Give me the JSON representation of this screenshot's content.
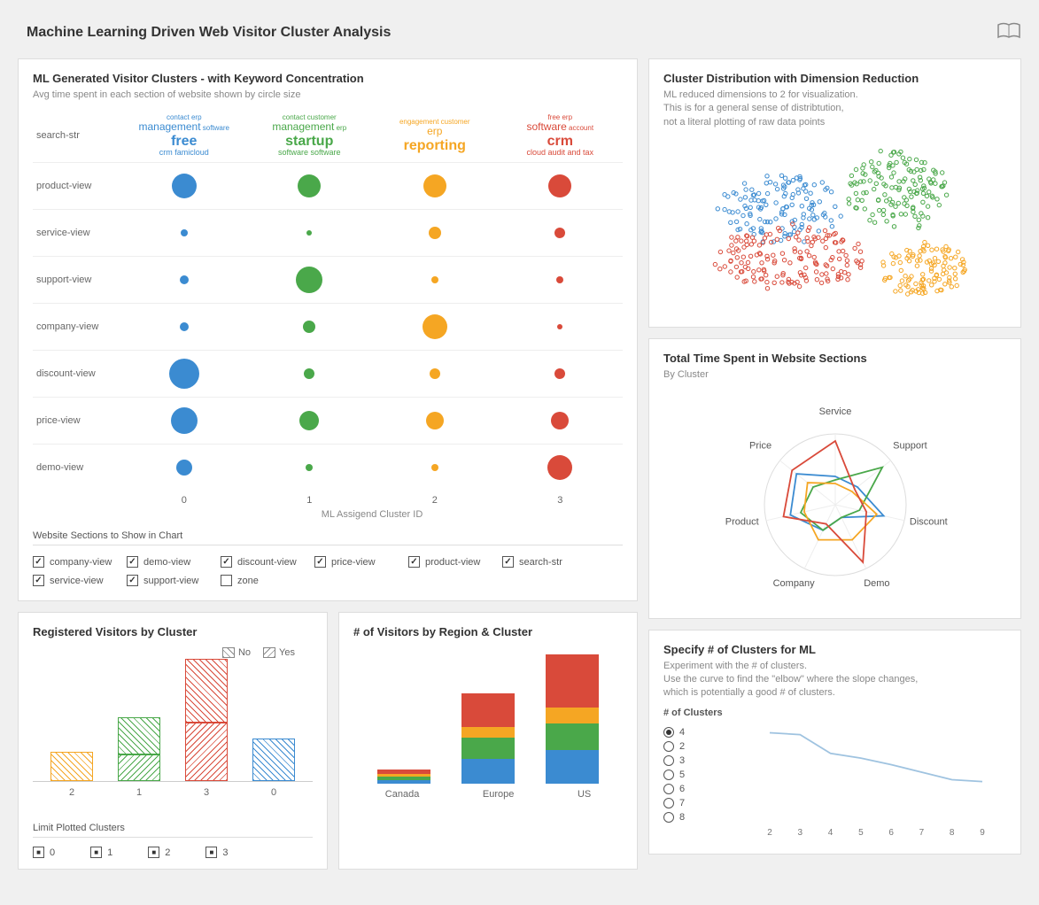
{
  "header": {
    "title": "Machine Learning Driven Web Visitor Cluster Analysis"
  },
  "colors": {
    "c0": "#3b8bd1",
    "c1": "#4aa84a",
    "c2": "#f5a623",
    "c3": "#d94a3a"
  },
  "bubble_panel": {
    "title": "ML Generated Visitor Clusters - with Keyword Concentration",
    "subtitle": "Avg time spent in each section of website shown by circle size",
    "xaxis": "ML Assigend Cluster ID",
    "rows": [
      "search-str",
      "product-view",
      "service-view",
      "support-view",
      "company-view",
      "discount-view",
      "price-view",
      "demo-view"
    ],
    "cluster_ids": [
      "0",
      "1",
      "2",
      "3"
    ],
    "wordclouds": [
      {
        "big": "free",
        "med": "management",
        "small": [
          "contact",
          "erp",
          "software",
          "crm",
          "famicloud"
        ]
      },
      {
        "big": "startup",
        "med": "management",
        "small": [
          "contact",
          "customer",
          "erp",
          "software",
          "software"
        ]
      },
      {
        "big": "reporting",
        "med": "erp",
        "small": [
          "engagement",
          "customer"
        ]
      },
      {
        "big": "crm",
        "med": "software",
        "small": [
          "free",
          "erp",
          "account",
          "cloud",
          "audit and",
          "tax"
        ]
      }
    ],
    "section_checks_title": "Website Sections to Show in Chart",
    "checks": [
      {
        "label": "company-view",
        "checked": true
      },
      {
        "label": "demo-view",
        "checked": true
      },
      {
        "label": "discount-view",
        "checked": true
      },
      {
        "label": "price-view",
        "checked": true
      },
      {
        "label": "product-view",
        "checked": true
      },
      {
        "label": "search-str",
        "checked": true
      },
      {
        "label": "service-view",
        "checked": true
      },
      {
        "label": "support-view",
        "checked": true
      },
      {
        "label": "zone",
        "checked": false
      }
    ]
  },
  "registered_panel": {
    "title": "Registered Visitors by Cluster",
    "legend": [
      "No",
      "Yes"
    ],
    "limit_title": "Limit Plotted Clusters",
    "limit_items": [
      "0",
      "1",
      "2",
      "3"
    ]
  },
  "region_panel": {
    "title": "# of Visitors by Region & Cluster",
    "regions": [
      "Canada",
      "Europe",
      "US"
    ]
  },
  "scatter_panel": {
    "title": "Cluster Distribution with Dimension Reduction",
    "subtitle": "ML reduced dimensions to 2 for visualization.\nThis is for a general sense of distribtution,\nnot a literal plotting of raw data points"
  },
  "radar_panel": {
    "title": "Total Time Spent in Website Sections",
    "subtitle": "By Cluster",
    "axes": [
      "Service",
      "Support",
      "Discount",
      "Demo",
      "Company",
      "Product",
      "Price"
    ]
  },
  "elbow_panel": {
    "title": "Specify # of Clusters for ML",
    "subtitle": "Experiment with the # of clusters.\nUse the curve to find the \"elbow\" where the slope changes,\nwhich is potentially a good # of clusters.",
    "radio_label": "# of Clusters",
    "options": [
      "4",
      "2",
      "3",
      "5",
      "6",
      "7",
      "8"
    ],
    "selected": "4",
    "xticks": [
      "2",
      "3",
      "4",
      "5",
      "6",
      "7",
      "8",
      "9"
    ]
  },
  "chart_data": [
    {
      "type": "bubble-matrix",
      "title": "ML Generated Visitor Clusters - with Keyword Concentration",
      "xlabel": "ML Assigend Cluster ID",
      "x": [
        0,
        1,
        2,
        3
      ],
      "y_categories": [
        "product-view",
        "service-view",
        "support-view",
        "company-view",
        "discount-view",
        "price-view",
        "demo-view"
      ],
      "size_matrix": [
        [
          28,
          26,
          26,
          26
        ],
        [
          8,
          6,
          14,
          12
        ],
        [
          10,
          30,
          8,
          8
        ],
        [
          10,
          14,
          28,
          6
        ],
        [
          34,
          12,
          12,
          12
        ],
        [
          30,
          22,
          20,
          20
        ],
        [
          18,
          8,
          8,
          28
        ]
      ]
    },
    {
      "type": "bar",
      "title": "Registered Visitors by Cluster",
      "categories": [
        "2",
        "1",
        "3",
        "0"
      ],
      "series": [
        {
          "name": "No",
          "values": [
            28,
            35,
            60,
            40
          ]
        },
        {
          "name": "Yes",
          "values": [
            0,
            25,
            55,
            0
          ]
        }
      ],
      "cluster_color": [
        "#f5a623",
        "#4aa84a",
        "#d94a3a",
        "#3b8bd1"
      ]
    },
    {
      "type": "bar",
      "title": "# of Visitors by Region & Cluster",
      "categories": [
        "Canada",
        "Europe",
        "US"
      ],
      "series": [
        {
          "name": "0",
          "values": [
            4,
            28,
            38
          ],
          "color": "#3b8bd1"
        },
        {
          "name": "1",
          "values": [
            4,
            24,
            30
          ],
          "color": "#4aa84a"
        },
        {
          "name": "2",
          "values": [
            3,
            12,
            18
          ],
          "color": "#f5a623"
        },
        {
          "name": "3",
          "values": [
            5,
            38,
            60
          ],
          "color": "#d94a3a"
        }
      ],
      "stacked": true
    },
    {
      "type": "scatter",
      "title": "Cluster Distribution with Dimension Reduction",
      "note": "2D embedding scatter; 4 color-coded clusters; axes unlabeled"
    },
    {
      "type": "radar",
      "title": "Total Time Spent in Website Sections",
      "axes": [
        "Service",
        "Support",
        "Discount",
        "Demo",
        "Company",
        "Product",
        "Price"
      ],
      "series": [
        {
          "name": "0",
          "color": "#3b8bd1",
          "values": [
            40,
            40,
            70,
            20,
            40,
            65,
            70
          ]
        },
        {
          "name": "1",
          "color": "#4aa84a",
          "values": [
            35,
            85,
            35,
            20,
            40,
            50,
            40
          ]
        },
        {
          "name": "2",
          "color": "#f5a623",
          "values": [
            30,
            30,
            60,
            55,
            55,
            45,
            50
          ]
        },
        {
          "name": "3",
          "color": "#d94a3a",
          "values": [
            90,
            35,
            45,
            90,
            30,
            75,
            78
          ]
        }
      ],
      "range": [
        0,
        100
      ]
    },
    {
      "type": "line",
      "title": "Specify # of Clusters for ML (elbow curve)",
      "x": [
        2,
        3,
        4,
        5,
        6,
        7,
        8,
        9
      ],
      "values": [
        92,
        90,
        70,
        65,
        58,
        50,
        42,
        40
      ],
      "ylim": [
        0,
        100
      ]
    }
  ]
}
